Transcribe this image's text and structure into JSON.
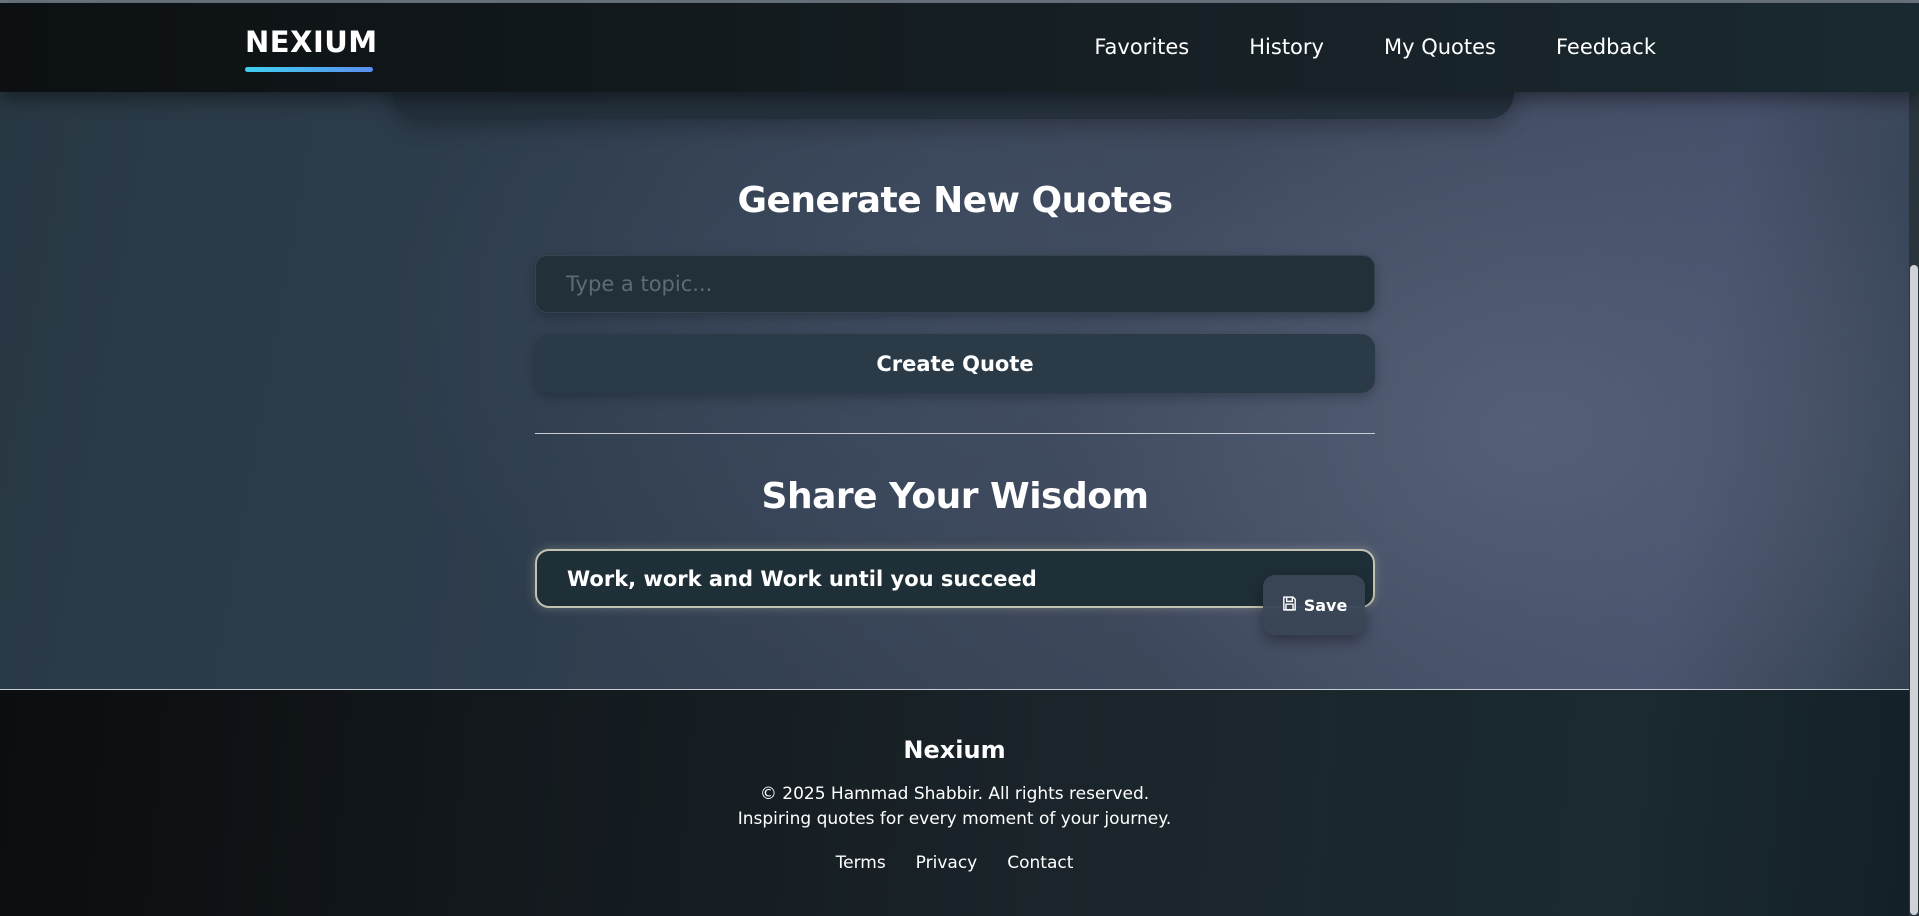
{
  "navbar": {
    "logo": "NEXIUM",
    "links": [
      "Favorites",
      "History",
      "My Quotes",
      "Feedback"
    ]
  },
  "generate": {
    "title": "Generate New Quotes",
    "topic_placeholder": "Type a topic...",
    "create_label": "Create Quote"
  },
  "share": {
    "title": "Share Your Wisdom",
    "quote_value": "Work, work and Work until you succeed",
    "save_label": "Save",
    "save_icon": "save-icon"
  },
  "footer": {
    "brand": "Nexium",
    "copyright": "© 2025 Hammad Shabbir. All rights reserved.",
    "tagline": "Inspiring quotes for every moment of your journey.",
    "links": [
      "Terms",
      "Privacy",
      "Contact"
    ]
  },
  "colors": {
    "logo_underline_start": "#3fd0ee",
    "logo_underline_end": "#5b8ef0",
    "input_focus_border": "#c3c2b2"
  }
}
